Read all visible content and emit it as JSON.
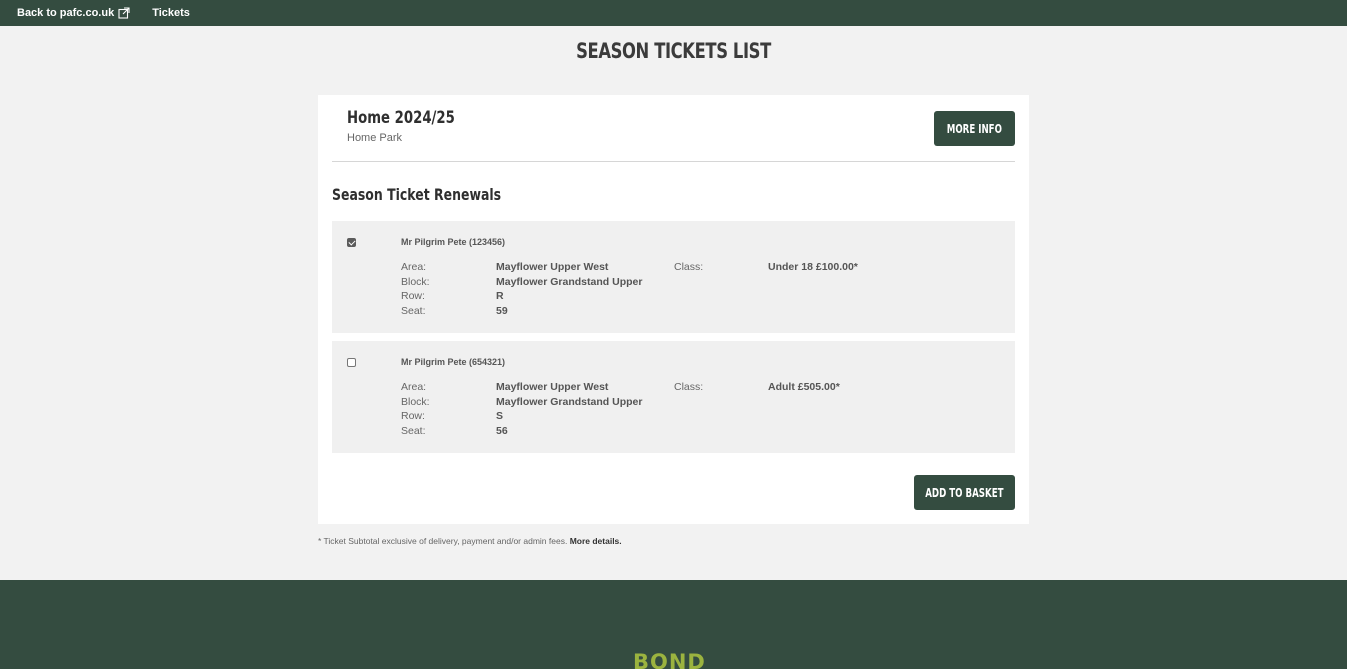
{
  "nav": {
    "back_label": "Back to pafc.co.uk",
    "tickets_label": "Tickets"
  },
  "page": {
    "title": "SEASON TICKETS LIST"
  },
  "season": {
    "name": "Home 2024/25",
    "venue": "Home Park",
    "more_info_label": "MORE INFO"
  },
  "renewals": {
    "title": "Season Ticket Renewals",
    "labels": {
      "area": "Area:",
      "block": "Block:",
      "row": "Row:",
      "seat": "Seat:",
      "class": "Class:"
    },
    "items": [
      {
        "holder": "Mr Pilgrim Pete (123456)",
        "checked": true,
        "area": "Mayflower Upper West",
        "block": "Mayflower Grandstand Upper",
        "row": "R",
        "seat": "59",
        "class": "Under 18 £100.00*"
      },
      {
        "holder": "Mr Pilgrim Pete (654321)",
        "checked": false,
        "area": "Mayflower Upper West",
        "block": "Mayflower Grandstand Upper",
        "row": "S",
        "seat": "56",
        "class": "Adult £505.00*"
      }
    ],
    "add_to_basket_label": "ADD TO BASKET"
  },
  "note": {
    "text": "* Ticket Subtotal exclusive of delivery, payment and/or admin fees.",
    "link": "More details."
  },
  "footer": {
    "logo_text": "BOND"
  },
  "colors": {
    "brand": "#344c40",
    "logo": "#9bb33f"
  }
}
